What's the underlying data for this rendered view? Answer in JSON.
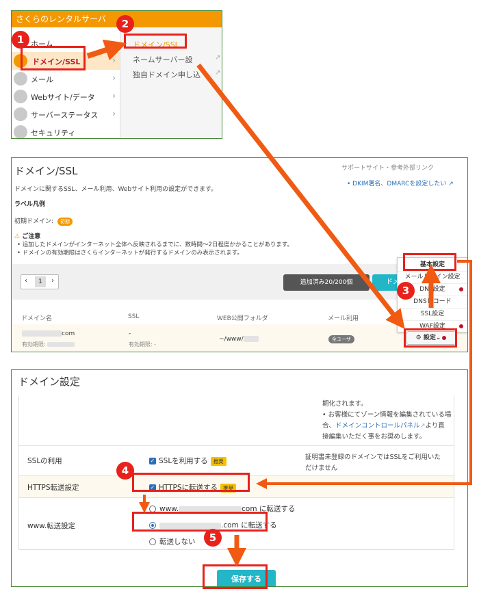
{
  "panel1": {
    "app_title": "さくらのレンタルサーバ",
    "menu": [
      {
        "label": "ホーム",
        "icon": "home-icon"
      },
      {
        "label": "ドメイン/SSL",
        "icon": "globe-icon"
      },
      {
        "label": "メール",
        "icon": "mail-icon"
      },
      {
        "label": "Webサイト/データ",
        "icon": "web-icon"
      },
      {
        "label": "サーバーステータス",
        "icon": "status-icon"
      },
      {
        "label": "セキュリティ",
        "icon": "shield-icon"
      }
    ],
    "submenu": [
      {
        "label": "ドメイン/SSL"
      },
      {
        "label": "ネームサーバー設"
      },
      {
        "label": "独自ドメイン申し込"
      }
    ]
  },
  "panel2": {
    "title": "ドメイン/SSL",
    "support_header": "サポートサイト・参考外部リンク",
    "dkim_link": "DKIM署名、DMARCを設定したい",
    "description": "ドメインに関するSSL、メール利用、Webサイト利用の設定ができます。",
    "legend_label": "ラベル凡例",
    "initial_domain_label": "初期ドメイン:",
    "initial_badge": "初期",
    "notice_title": "ご注意",
    "notices": [
      "追加したドメインがインターネット全体へ反映されるまでに、数時間〜2日程度かかることがあります。",
      "ドメインの有効期限はさくらインターネットが発行するドメインのみ表示されます。"
    ],
    "pager_current": "1",
    "added_count": "追加済み20/200個",
    "add_domain_button": "ドメ",
    "columns": [
      "ドメイン名",
      "SSL",
      "WEB公開フォルダ",
      "メール利用"
    ],
    "row": {
      "domain_suffix": "com",
      "expiry_label": "有効期限:",
      "ssl": "-",
      "ssl_expiry": "有効期限: -",
      "web_folder": "~/www/",
      "mail_badge": "全ユーザ"
    },
    "dropdown": [
      "基本設定",
      "メールドメイン設定",
      "DNS設定",
      "DNSレコード",
      "SSL設定",
      "WAF設定"
    ],
    "settings_button": "設定"
  },
  "panel3": {
    "title": "ドメイン設定",
    "top_notes": [
      "期化されます。",
      "お客様にてゾーン情報を編集されている場",
      "合、",
      "ドメインコントロールパネル",
      "より直",
      "接編集いただく事をお奨めします。"
    ],
    "ssl_label": "SSLの利用",
    "ssl_checkbox": "SSLを利用する",
    "ssl_badge": "推奨",
    "ssl_note1": "証明書未登録のドメインではSSLをご利用いた",
    "ssl_note2": "だけません",
    "https_label": "HTTPS転送設定",
    "https_checkbox": "HTTPSに転送する",
    "https_badge": "推奨",
    "www_label": "www.転送設定",
    "www_option1_prefix": "www.",
    "www_option1_suffix": "com に転送する",
    "www_option2_suffix": ".com に転送する",
    "www_option3": "転送しない",
    "save_button": "保存する"
  },
  "steps": [
    "1",
    "2",
    "3",
    "4",
    "5"
  ],
  "colors": {
    "accent_orange": "#f39800",
    "highlight_red": "#e8211b",
    "teal": "#23b6c6",
    "link_blue": "#2a6fb8"
  }
}
